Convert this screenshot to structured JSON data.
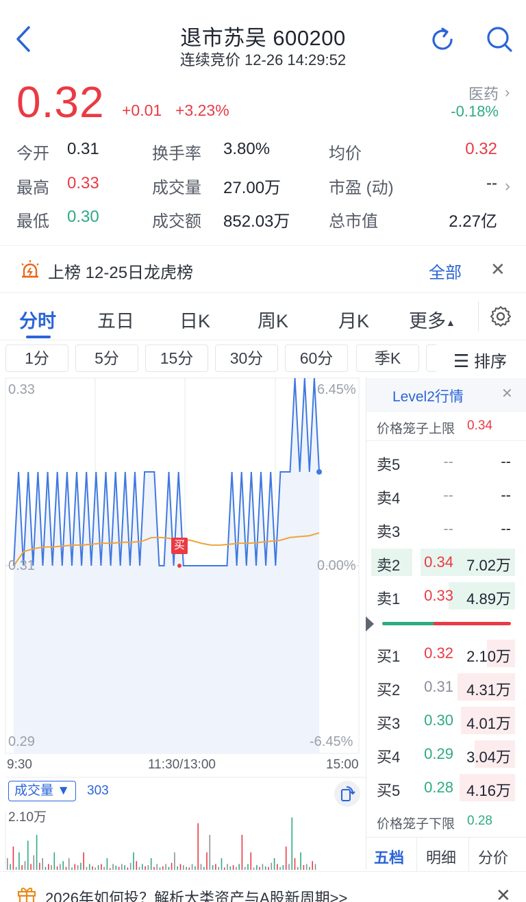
{
  "header": {
    "title": "退市苏吴 600200",
    "subtitle": "连续竞价 12-26 14:29:52"
  },
  "quote": {
    "price": "0.32",
    "change": "+0.01",
    "change_pct": "+3.23%",
    "sector_name": "医药",
    "sector_pct": "-0.18%",
    "stats": [
      {
        "label": "今开",
        "value": "0.31",
        "color": "dark"
      },
      {
        "label": "换手率",
        "value": "3.80%",
        "color": "dark"
      },
      {
        "label": "均价",
        "value": "0.32",
        "color": "red"
      },
      {
        "label": "最高",
        "value": "0.33",
        "color": "red"
      },
      {
        "label": "成交量",
        "value": "27.00万",
        "color": "dark"
      },
      {
        "label": "市盈 (动)",
        "value": "--",
        "color": "dark"
      },
      {
        "label": "最低",
        "value": "0.30",
        "color": "green"
      },
      {
        "label": "成交额",
        "value": "852.03万",
        "color": "dark"
      },
      {
        "label": "总市值",
        "value": "2.27亿",
        "color": "dark"
      }
    ]
  },
  "alert": {
    "text": "上榜 12-25日龙虎榜",
    "all_label": "全部",
    "close": "✕"
  },
  "tabs": [
    "分时",
    "五日",
    "日K",
    "周K",
    "月K",
    "更多"
  ],
  "subtabs": [
    "1分",
    "5分",
    "15分",
    "30分",
    "60分",
    "季K"
  ],
  "sort_label": "排序",
  "chart": {
    "y_top": "0.33",
    "y_mid": "0.31",
    "y_bottom": "0.29",
    "pct_top": "6.45%",
    "pct_mid": "0.00%",
    "pct_bottom": "-6.45%",
    "time_start": "9:30",
    "time_mid": "11:30/13:00",
    "time_end": "15:00",
    "buy_marker": "买",
    "volume_label": "成交量",
    "volume_value": "303",
    "volume_max": "2.10万"
  },
  "chart_data": {
    "type": "line",
    "ylim": [
      0.29,
      0.33
    ],
    "series": [
      {
        "values": [
          0.31,
          0.32,
          0.31,
          0.32,
          0.31,
          0.32,
          0.31,
          0.32,
          0.31,
          0.32,
          0.31,
          0.32,
          0.31,
          0.32,
          0.31,
          0.32,
          0.31,
          0.32,
          0.31,
          0.32,
          0.31,
          0.32,
          0.31,
          0.32,
          0.31,
          0.32,
          0.31,
          0.32,
          0.32,
          0.32,
          0.31,
          0.31,
          0.32,
          0.31,
          0.32,
          0.31,
          0.31,
          0.31,
          0.31,
          0.31,
          0.31,
          0.31,
          0.31,
          0.31,
          0.31,
          0.32,
          0.31,
          0.32,
          0.31,
          0.32,
          0.31,
          0.32,
          0.31,
          0.32,
          0.31,
          0.32,
          0.32,
          0.32,
          0.33,
          0.32,
          0.33,
          0.32,
          0.33,
          0.32
        ]
      },
      {
        "values": [
          0.31,
          0.3115,
          0.3118,
          0.312,
          0.312,
          0.3121,
          0.3122,
          0.3122,
          0.3123,
          0.3124,
          0.3124,
          0.3125,
          0.3125,
          0.3126,
          0.313,
          0.313,
          0.3129,
          0.3128,
          0.3127,
          0.3124,
          0.3122,
          0.3122,
          0.3123,
          0.3124,
          0.3124,
          0.3125,
          0.3126,
          0.3127,
          0.313,
          0.3131,
          0.3132,
          0.3135
        ]
      }
    ]
  },
  "orderbook": {
    "title": "Level2行情",
    "upper_limit_label": "价格笼子上限",
    "upper_limit_value": "0.34",
    "lower_limit_label": "价格笼子下限",
    "lower_limit_value": "0.28",
    "sells": [
      {
        "label": "卖5",
        "price": "--",
        "vol": "--",
        "fill": 0
      },
      {
        "label": "卖4",
        "price": "--",
        "vol": "--",
        "fill": 0
      },
      {
        "label": "卖3",
        "price": "--",
        "vol": "--",
        "fill": 0
      },
      {
        "label": "卖2",
        "price": "0.34",
        "vol": "7.02万",
        "fill": 1.0
      },
      {
        "label": "卖1",
        "price": "0.33",
        "vol": "4.89万",
        "fill": 0.7
      }
    ],
    "buys": [
      {
        "label": "买1",
        "price": "0.32",
        "vol": "2.10万",
        "fill": 0.3,
        "price_color": "red"
      },
      {
        "label": "买2",
        "price": "0.31",
        "vol": "4.31万",
        "fill": 0.61,
        "price_color": "gray"
      },
      {
        "label": "买3",
        "price": "0.30",
        "vol": "4.01万",
        "fill": 0.57,
        "price_color": "green"
      },
      {
        "label": "买4",
        "price": "0.29",
        "vol": "3.04万",
        "fill": 0.43,
        "price_color": "green"
      },
      {
        "label": "买5",
        "price": "0.28",
        "vol": "4.16万",
        "fill": 0.59,
        "price_color": "green"
      }
    ],
    "bottom_tabs": [
      "五档",
      "明细",
      "分价"
    ]
  },
  "footer": {
    "text": "2026年如何投？解析大类资产与A股新周期>>",
    "close": "✕"
  }
}
